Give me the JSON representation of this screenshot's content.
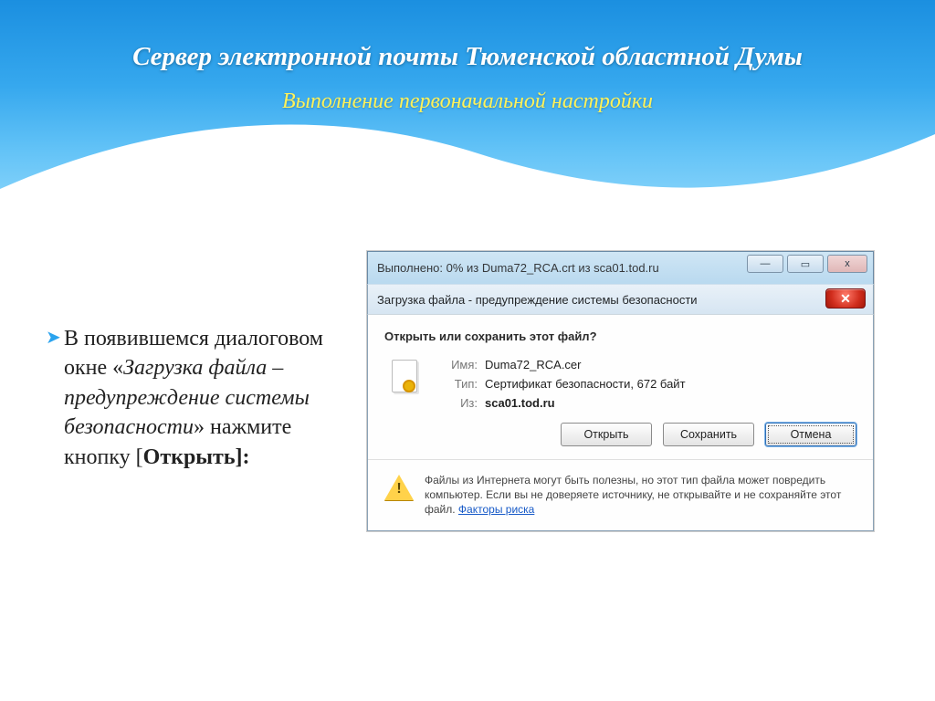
{
  "slide": {
    "title": "Сервер электронной почты Тюменской областной Думы",
    "subtitle": "Выполнение первоначальной настройки"
  },
  "bullet": {
    "seg1": "В появившемся диалоговом окне «",
    "seg2_italic": "Загрузка файла – предупреждение системы безопасности",
    "seg3": "» нажмите кнопку ",
    "seg4_open_bracket": "[",
    "seg5_bold": "Открыть]:",
    "marker": "➤"
  },
  "progress_window": {
    "title": "Выполнено: 0% из Duma72_RCA.crt из sca01.tod.ru",
    "btn_min": "—",
    "btn_max": "▭",
    "btn_close": "x"
  },
  "dialog": {
    "titlebar": "Загрузка файла - предупреждение системы безопасности",
    "close_glyph": "✕",
    "question": "Открыть или сохранить этот файл?",
    "labels": {
      "name": "Имя:",
      "type": "Тип:",
      "from": "Из:"
    },
    "file": {
      "name": "Duma72_RCA.cer",
      "type": "Сертификат безопасности, 672 байт",
      "from": "sca01.tod.ru"
    },
    "buttons": {
      "open": "Открыть",
      "save": "Сохранить",
      "cancel": "Отмена"
    },
    "warning": {
      "text": "Файлы из Интернета могут быть полезны, но этот тип файла может повредить компьютер. Если вы не доверяете источнику, не открывайте и не сохраняйте этот файл. ",
      "link": "Факторы риска",
      "bang": "!"
    }
  }
}
